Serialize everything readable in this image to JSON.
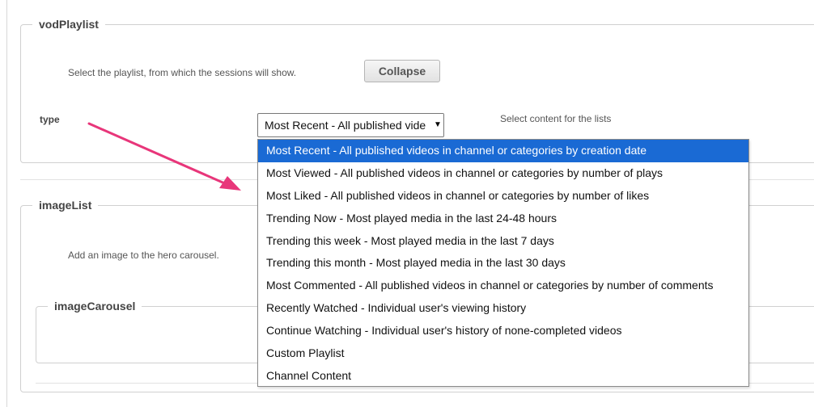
{
  "vod_playlist": {
    "legend": "vodPlaylist",
    "description": "Select the playlist, from which the sessions will show.",
    "collapse_label": "Collapse",
    "type_label": "type",
    "select_value": "Most Recent - All published vide",
    "select_hint": "Select content for the lists"
  },
  "image_list": {
    "legend": "imageList",
    "description": "Add an image to the hero carousel."
  },
  "image_carousel": {
    "legend": "imageCarousel"
  },
  "dropdown": {
    "selected_index": 0,
    "options": [
      "Most Recent - All published videos in channel or categories by creation date",
      "Most Viewed - All published videos in channel or categories by number of plays",
      "Most Liked - All published videos in channel or categories by number of likes",
      "Trending Now - Most played media in the last 24-48 hours",
      "Trending this week - Most played media in the last 7 days",
      "Trending this month - Most played media in the last 30 days",
      "Most Commented - All published videos in channel or categories by number of comments",
      "Recently Watched - Individual user's viewing history",
      "Continue Watching - Individual user's history of none-completed videos",
      "Custom Playlist",
      "Channel Content"
    ]
  },
  "colors": {
    "highlight": "#1a6ad4",
    "annotation_arrow": "#e8367a"
  }
}
